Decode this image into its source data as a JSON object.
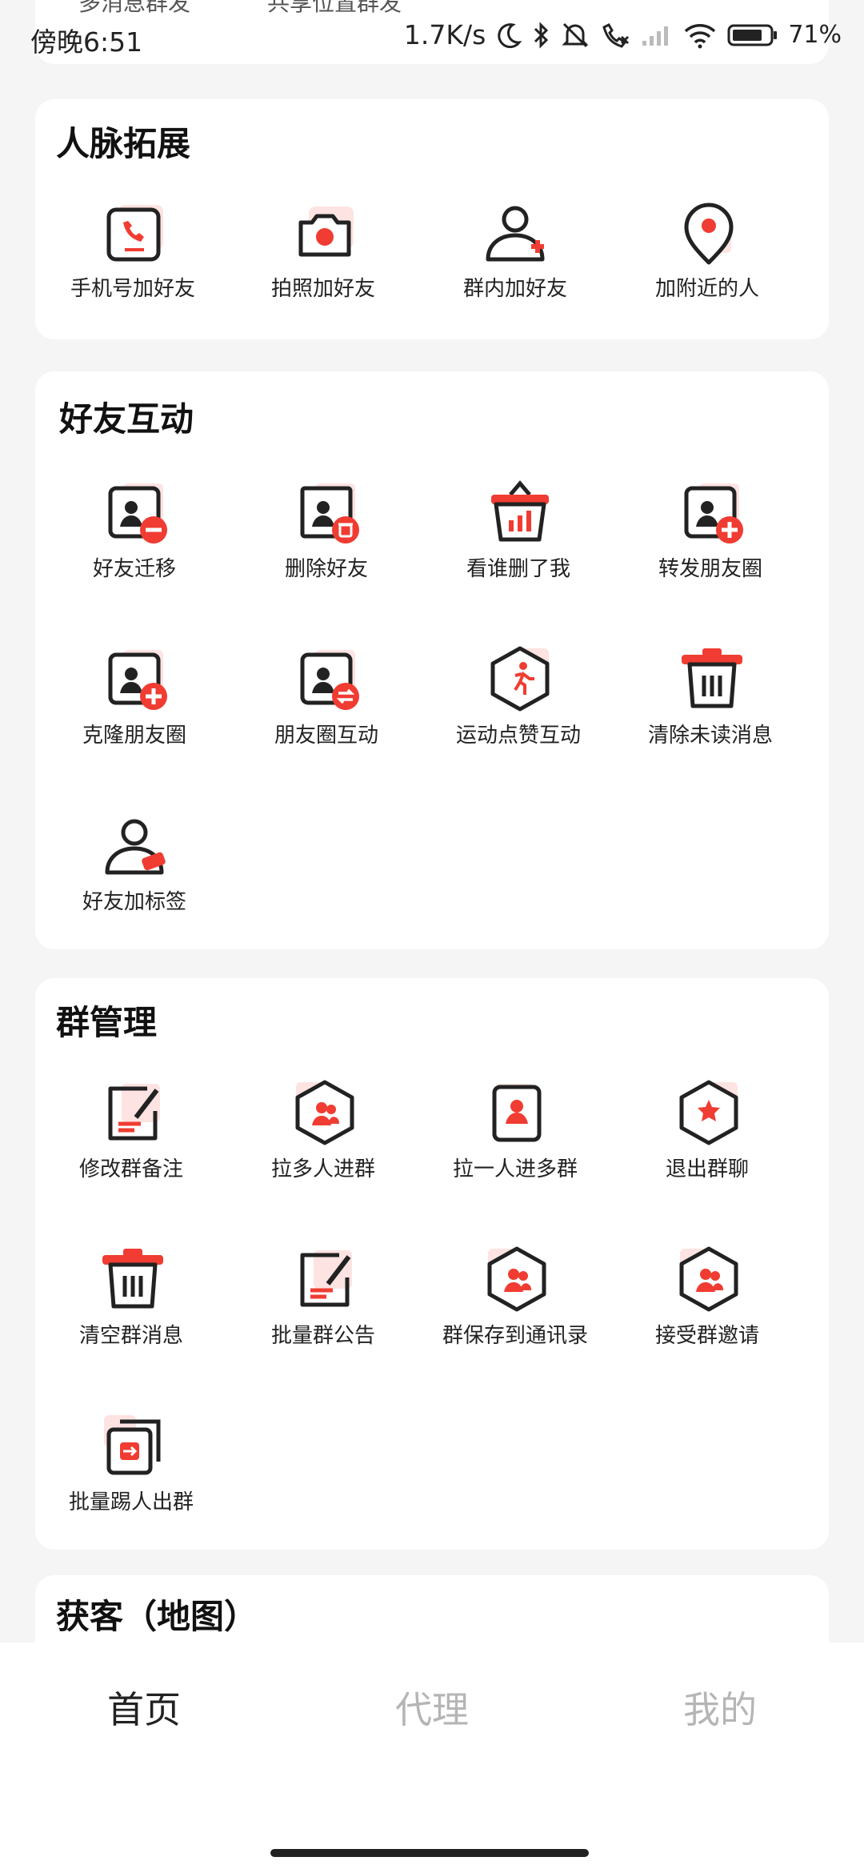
{
  "status_bar": {
    "time": "傍晚6:51",
    "speed": "1.7K/s",
    "battery": "71%"
  },
  "peek": {
    "left": "多消息群发",
    "right": "共享位置群发"
  },
  "sections": {
    "network": {
      "title": "人脉拓展",
      "items": [
        "手机号加好友",
        "拍照加好友",
        "群内加好友",
        "加附近的人"
      ]
    },
    "friends": {
      "title": "好友互动",
      "items": [
        "好友迁移",
        "删除好友",
        "看谁删了我",
        "转发朋友圈",
        "克隆朋友圈",
        "朋友圈互动",
        "运动点赞互动",
        "清除未读消息",
        "好友加标签"
      ]
    },
    "groups": {
      "title": "群管理",
      "items": [
        "修改群备注",
        "拉多人进群",
        "拉一人进多群",
        "退出群聊",
        "清空群消息",
        "批量群公告",
        "群保存到通讯录",
        "接受群邀请",
        "批量踢人出群"
      ]
    },
    "map": {
      "title": "获客（地图）"
    }
  },
  "tabs": {
    "home": "首页",
    "agent": "代理",
    "mine": "我的"
  },
  "colors": {
    "accent": "#f03c32",
    "text": "#222222",
    "inactive": "#b5b5b5"
  }
}
